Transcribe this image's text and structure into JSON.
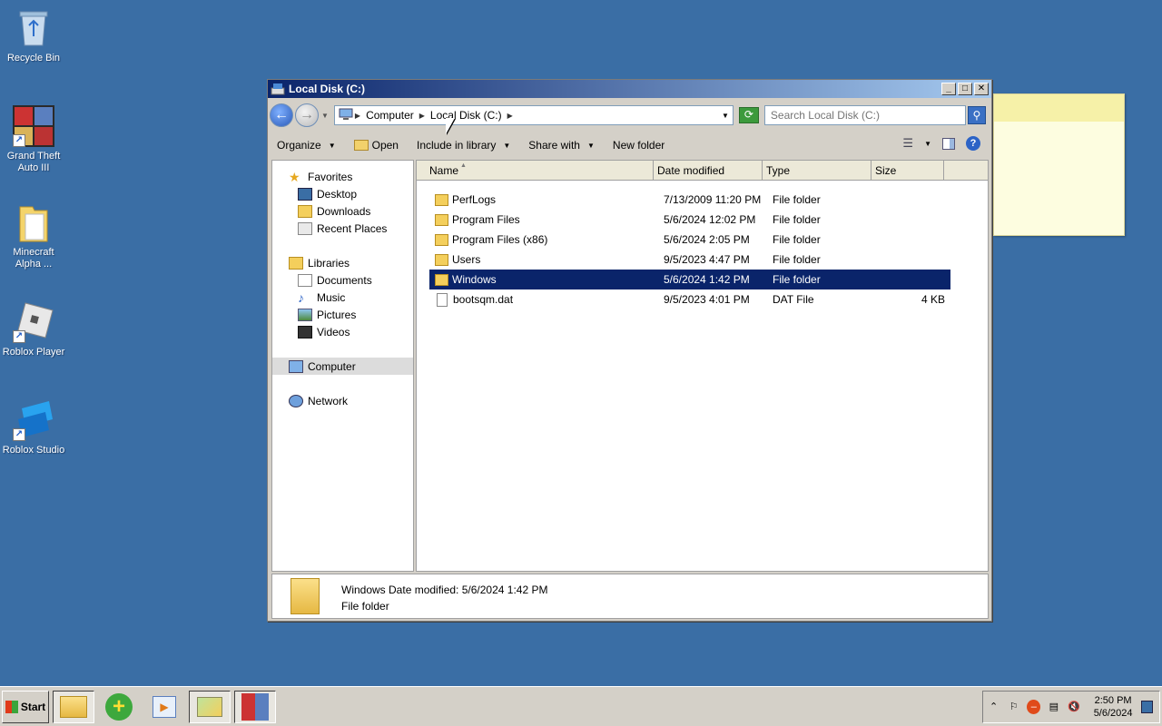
{
  "desktop": {
    "icons": [
      {
        "label": "Recycle Bin"
      },
      {
        "label": "Grand Theft Auto III"
      },
      {
        "label": "Minecraft Alpha ..."
      },
      {
        "label": "Roblox Player"
      },
      {
        "label": "Roblox Studio"
      }
    ]
  },
  "window": {
    "title": "Local Disk (C:)",
    "address": {
      "crumbs": [
        "Computer",
        "Local Disk (C:)"
      ]
    },
    "search": {
      "placeholder": "Search Local Disk (C:)"
    },
    "toolbar": {
      "organize": "Organize",
      "open": "Open",
      "include": "Include in library",
      "share": "Share with",
      "newfolder": "New folder"
    },
    "nav": {
      "favorites": "Favorites",
      "desktop": "Desktop",
      "downloads": "Downloads",
      "recent": "Recent Places",
      "libraries": "Libraries",
      "documents": "Documents",
      "music": "Music",
      "pictures": "Pictures",
      "videos": "Videos",
      "computer": "Computer",
      "network": "Network"
    },
    "columns": {
      "name": "Name",
      "date": "Date modified",
      "type": "Type",
      "size": "Size"
    },
    "files": [
      {
        "name": "PerfLogs",
        "date": "7/13/2009 11:20 PM",
        "type": "File folder",
        "size": ""
      },
      {
        "name": "Program Files",
        "date": "5/6/2024 12:02 PM",
        "type": "File folder",
        "size": ""
      },
      {
        "name": "Program Files (x86)",
        "date": "5/6/2024 2:05 PM",
        "type": "File folder",
        "size": ""
      },
      {
        "name": "Users",
        "date": "9/5/2023 4:47 PM",
        "type": "File folder",
        "size": ""
      },
      {
        "name": "Windows",
        "date": "5/6/2024 1:42 PM",
        "type": "File folder",
        "size": ""
      },
      {
        "name": "bootsqm.dat",
        "date": "9/5/2023 4:01 PM",
        "type": "DAT File",
        "size": "4 KB"
      }
    ],
    "details": {
      "line1": "Windows Date modified:  5/6/2024 1:42 PM",
      "line2": "File folder"
    }
  },
  "taskbar": {
    "start": "Start",
    "clock_time": "2:50 PM",
    "clock_date": "5/6/2024"
  },
  "colors": {
    "desktop": "#3a6ea5",
    "selection": "#0a246a",
    "titlebar_start": "#0a246a",
    "titlebar_end": "#a6caf0"
  }
}
